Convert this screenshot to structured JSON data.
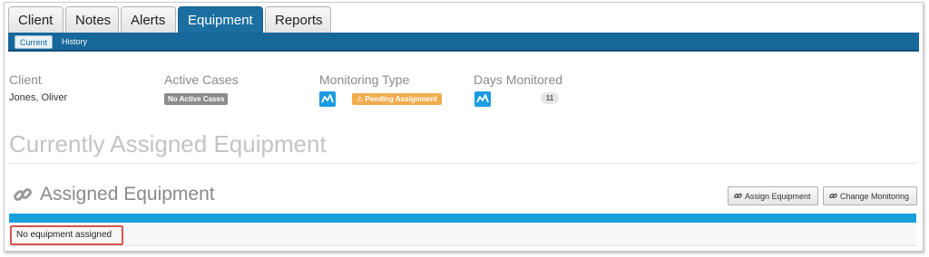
{
  "tabs": [
    {
      "label": "Client"
    },
    {
      "label": "Notes"
    },
    {
      "label": "Alerts"
    },
    {
      "label": "Equipment",
      "active": true
    },
    {
      "label": "Reports"
    }
  ],
  "subtabs": [
    {
      "label": "Current",
      "active": true
    },
    {
      "label": "History"
    }
  ],
  "info": {
    "client_label": "Client",
    "client_value": "Jones, Oliver",
    "active_cases_label": "Active Cases",
    "active_cases_badge": "No Active Cases",
    "monitoring_type_label": "Monitoring Type",
    "monitoring_type_badge": "⚠ Pending Assignment",
    "days_monitored_label": "Days Monitored",
    "days_monitored_value": "11"
  },
  "main": {
    "heading": "Currently Assigned Equipment",
    "section_title": "Assigned Equipment",
    "assign_button": "Assign Equipment",
    "change_button": "Change Monitoring",
    "empty_message": "No equipment assigned"
  },
  "colors": {
    "active_tab": "#1a6fa0",
    "subbar": "#16679a",
    "table_header": "#1aa0d9",
    "pending_badge": "#f0ad4e",
    "highlight_border": "#d9534f"
  },
  "icons": {
    "monitoring": "monitor-chart-icon",
    "section": "link-icon",
    "buttons": "link-icon"
  }
}
